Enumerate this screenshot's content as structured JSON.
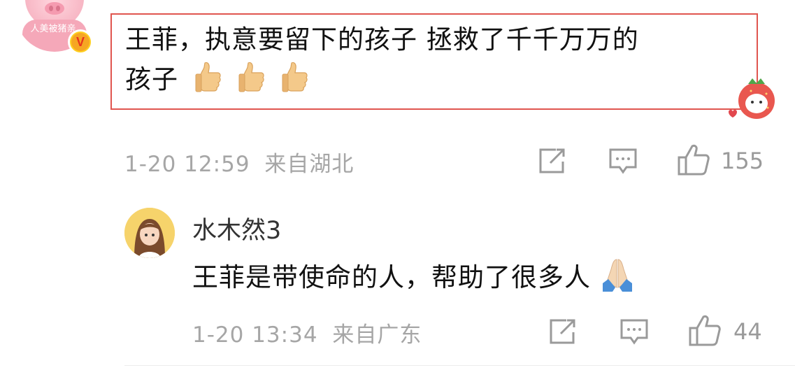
{
  "comment": {
    "avatar_banner": "人美被猪亲",
    "vip_badge": "V",
    "text_line1": "王菲，执意要留下的孩子  拯救了千千万万的",
    "text_line2": "孩子",
    "emoji": [
      "thumbs-up-emoji",
      "thumbs-up-emoji",
      "thumbs-up-emoji"
    ],
    "date": "1-20 12:59",
    "location": "来自湖北",
    "like_count": "155",
    "highlight_color": "#e0554f"
  },
  "reply": {
    "username": "水木然3",
    "text": "王菲是带使命的人，帮助了很多人",
    "emoji": "folded-hands-emoji",
    "date": "1-20 13:34",
    "location": "来自广东",
    "like_count": "44"
  },
  "colors": {
    "meta_text": "#a6a6a6",
    "icon": "#9a9a9a",
    "vip_gold": "#ffcf1f"
  }
}
